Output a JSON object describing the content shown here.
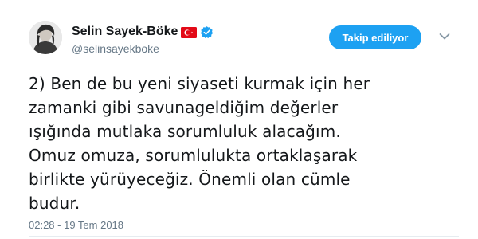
{
  "author": {
    "display_name": "Selin Sayek-Böke",
    "handle": "@selinsayekboke",
    "flag_icon": "turkey-flag-icon",
    "verified_icon": "verified-badge-icon",
    "avatar_icon": "profile-avatar"
  },
  "follow_button": {
    "label": "Takip ediliyor",
    "color": "#1da1f2"
  },
  "menu_icon": "chevron-down-icon",
  "tweet": {
    "text": "2) Ben de bu yeni siyaseti kurmak için her\nzamanki gibi savunageldiğim değerler\nışığında mutlaka sorumluluk alacağım.\nOmuz omuza, sorumlulukta ortaklaşarak\nbirlikte yürüyeceğiz.  Önemli olan cümle\nbudur.",
    "timestamp": "02:28 - 19 Tem 2018"
  },
  "colors": {
    "text_primary": "#14171a",
    "text_secondary": "#657786",
    "accent": "#1da1f2",
    "flag_red": "#e30a17"
  }
}
